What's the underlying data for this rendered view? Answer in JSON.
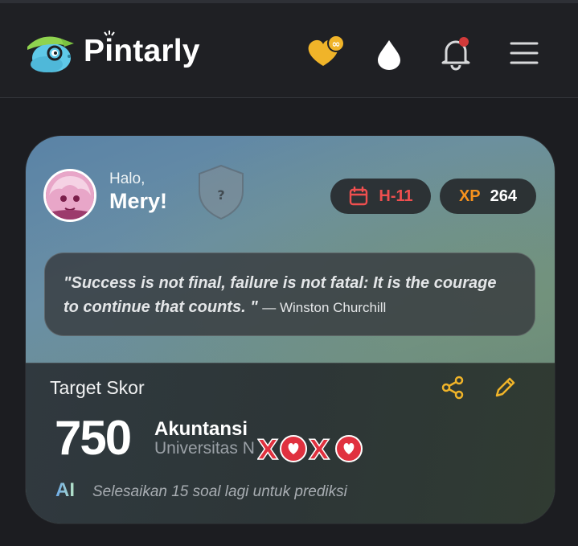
{
  "header": {
    "brand": "Pintarly",
    "icons": [
      "dino-logo-icon",
      "heart-infinity-icon",
      "drop-icon",
      "bell-icon",
      "menu-icon"
    ],
    "heart_badge": "∞",
    "colors": {
      "background": "#1f2024",
      "heart": "#f0b429",
      "bell_dot": "#d23a3a"
    }
  },
  "profile": {
    "greeting": "Halo,",
    "name": "Mery!",
    "shield_glyph": "?",
    "countdown": "H-11",
    "xp_label": "XP",
    "xp_value": "264",
    "colors": {
      "countdown": "#ef4f4f",
      "xp_label": "#f6921e"
    }
  },
  "quote": {
    "text": "\"Success is not final, failure is not fatal: It is the courage to continue that counts. \"",
    "author": "— Winston Churchill"
  },
  "target": {
    "label": "Target Skor",
    "score": "750",
    "major": "Akuntansi",
    "university": "Universitas N",
    "ai_label": "AI",
    "ai_hint": "Selesaikan 15 soal lagi untuk prediksi",
    "colors": {
      "action_icons": "#f0b429"
    }
  }
}
